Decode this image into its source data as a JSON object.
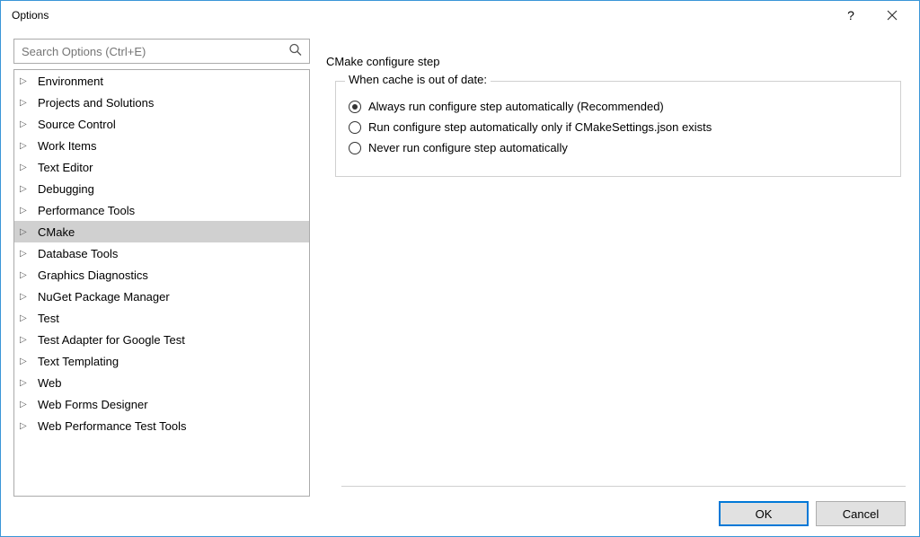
{
  "window": {
    "title": "Options",
    "help_label": "?",
    "close_label": "Close"
  },
  "search": {
    "placeholder": "Search Options (Ctrl+E)"
  },
  "tree": {
    "items": [
      {
        "label": "Environment"
      },
      {
        "label": "Projects and Solutions"
      },
      {
        "label": "Source Control"
      },
      {
        "label": "Work Items"
      },
      {
        "label": "Text Editor"
      },
      {
        "label": "Debugging"
      },
      {
        "label": "Performance Tools"
      },
      {
        "label": "CMake",
        "selected": true
      },
      {
        "label": "Database Tools"
      },
      {
        "label": "Graphics Diagnostics"
      },
      {
        "label": "NuGet Package Manager"
      },
      {
        "label": "Test"
      },
      {
        "label": "Test Adapter for Google Test"
      },
      {
        "label": "Text Templating"
      },
      {
        "label": "Web"
      },
      {
        "label": "Web Forms Designer"
      },
      {
        "label": "Web Performance Test Tools"
      }
    ]
  },
  "panel": {
    "header": "CMake configure step",
    "group_legend": "When cache is out of date:",
    "options": [
      {
        "label": "Always run configure step automatically (Recommended)",
        "checked": true
      },
      {
        "label": "Run configure step automatically only if CMakeSettings.json exists",
        "checked": false
      },
      {
        "label": "Never run configure step automatically",
        "checked": false
      }
    ]
  },
  "buttons": {
    "ok": "OK",
    "cancel": "Cancel"
  }
}
